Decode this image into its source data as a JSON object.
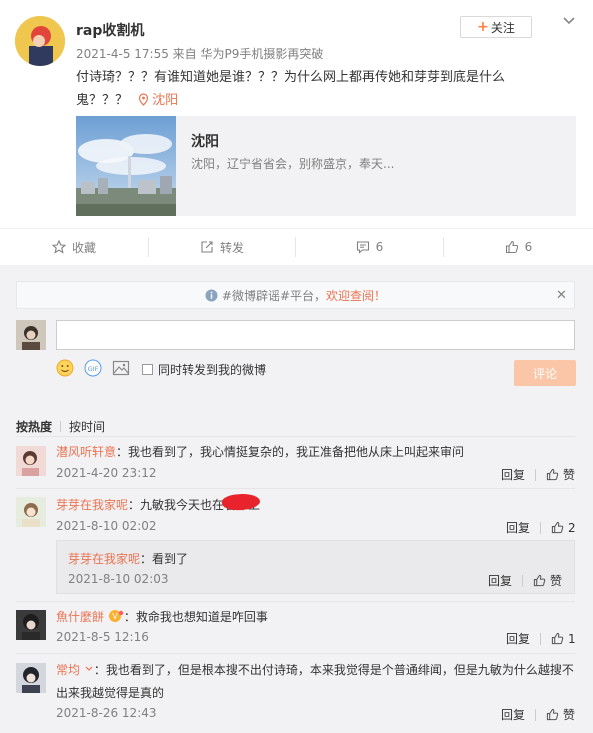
{
  "post": {
    "username": "rap收割机",
    "meta": "2021-4-5 17:55 来自 华为P9手机摄影再突破",
    "follow_label": "关注",
    "text": "付诗琦？？？有谁知道她是谁？？？为什么网上都再传她和芽芽到底是什么鬼？？？",
    "location": "沈阳",
    "card": {
      "title": "沈阳",
      "subtitle": "沈阳，辽宁省省会，别称盛京，奉天..."
    },
    "actions": {
      "favorite": "收藏",
      "forward": "转发",
      "comment_count": "6",
      "like_count": "6"
    }
  },
  "comments_panel": {
    "notice": {
      "prefix": "#微博辟谣#平台，",
      "highlight": "欢迎查阅！"
    },
    "input_placeholder": "",
    "forward_label": "同时转发到我的微博",
    "submit_label": "评论",
    "sort": {
      "active": "按热度",
      "inactive": "按时间"
    },
    "comments": [
      {
        "name": "潜风听轩意",
        "text": "：我也看到了，我心情挺复杂的，我正准备把他从床上叫起来审问",
        "time": "2021-4-20 23:12",
        "reply": "回复",
        "like": "赞"
      },
      {
        "name": "芽芽在我家呢",
        "text": "：九敏我今天也在看床上",
        "time": "2021-8-10 02:02",
        "reply": "回复",
        "like": "2",
        "sub": {
          "name": "芽芽在我家呢",
          "text": "：看到了",
          "time": "2021-8-10 02:03",
          "reply": "回复",
          "like": "赞"
        }
      },
      {
        "name": "魚什麼餅",
        "text": "：救命我也想知道是咋回事",
        "time": "2021-8-5 12:16",
        "reply": "回复",
        "like": "1"
      },
      {
        "name": "常均",
        "text_line1": "：我也看到了，但是根本搜不出付诗琦，本来我觉得是个普通绯闻，但是九敏为什么越搜不",
        "text_line2": "出来我越觉得是真的",
        "time": "2021-8-26 12:43",
        "reply": "回复",
        "like": "赞"
      }
    ]
  },
  "colors": {
    "accent": "#eb7350",
    "orange_btn": "#fbc6a7",
    "bg_gray": "#f2f2f5"
  }
}
